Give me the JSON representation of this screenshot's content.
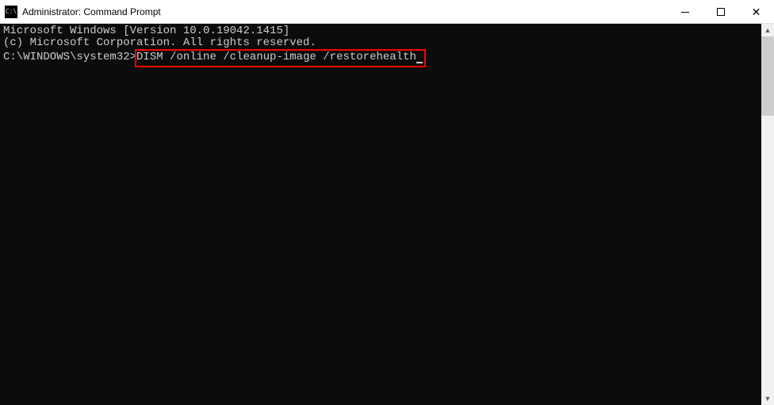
{
  "window": {
    "title": "Administrator: Command Prompt",
    "icon_label": "C:\\"
  },
  "terminal": {
    "line1": "Microsoft Windows [Version 10.0.19042.1415]",
    "line2": "(c) Microsoft Corporation. All rights reserved.",
    "blank": "",
    "prompt": "C:\\WINDOWS\\system32>",
    "command": "DISM /online /cleanup-image /restorehealth"
  }
}
